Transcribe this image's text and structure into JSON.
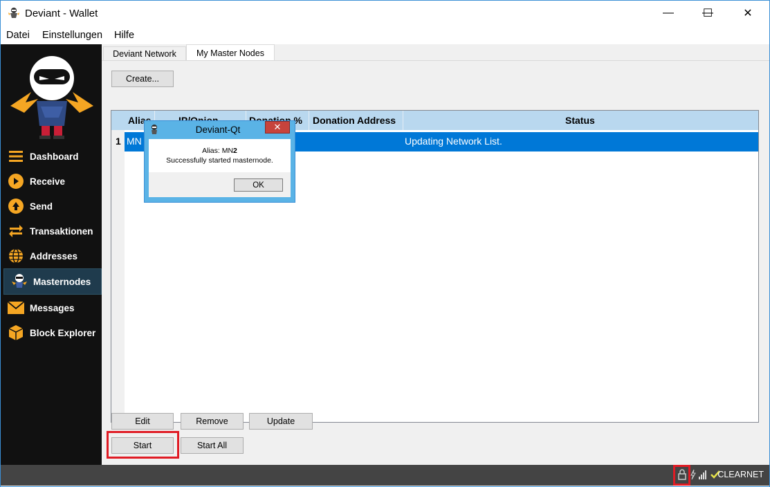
{
  "window": {
    "title": "Deviant - Wallet",
    "minimize_glyph": "—",
    "maximize_glyph": "☐",
    "close_glyph": "✕"
  },
  "menu": [
    "Datei",
    "Einstellungen",
    "Hilfe"
  ],
  "sidebar": {
    "items": [
      {
        "label": "Dashboard",
        "icon": "dashboard-icon"
      },
      {
        "label": "Receive",
        "icon": "receive-icon"
      },
      {
        "label": "Send",
        "icon": "send-icon"
      },
      {
        "label": "Transaktionen",
        "icon": "transactions-icon"
      },
      {
        "label": "Addresses",
        "icon": "addresses-icon"
      },
      {
        "label": "Masternodes",
        "icon": "masternodes-icon",
        "active": true
      },
      {
        "label": "Messages",
        "icon": "messages-icon"
      },
      {
        "label": "Block Explorer",
        "icon": "block-explorer-icon"
      }
    ]
  },
  "tabs": [
    {
      "label": "Deviant Network",
      "active": false
    },
    {
      "label": "My Master Nodes",
      "active": true
    }
  ],
  "buttons": {
    "create": "Create...",
    "edit": "Edit",
    "remove": "Remove",
    "update": "Update",
    "start": "Start",
    "start_all": "Start All"
  },
  "table": {
    "columns": [
      "Alias",
      "IP/Onion",
      "Donation %",
      "Donation Address",
      "Status"
    ],
    "rows": [
      {
        "num": "1",
        "alias": "MN",
        "ip": "",
        "donation_pct": "",
        "donation_address": "",
        "status": "Updating Network List."
      }
    ]
  },
  "dialog": {
    "title": "Deviant-Qt",
    "close_glyph": "✕",
    "alias_prefix": "Alias: MN",
    "alias_suffix": "2",
    "message": "Successfully started masternode.",
    "ok": "OK"
  },
  "statusbar": {
    "network": "CLEARNET"
  },
  "colors": {
    "sidebar_bg": "#111111",
    "accent_orange": "#f5a623",
    "selection_blue": "#0078d7",
    "header_blue": "#b9d8ef",
    "highlight_red": "#e01b24"
  }
}
